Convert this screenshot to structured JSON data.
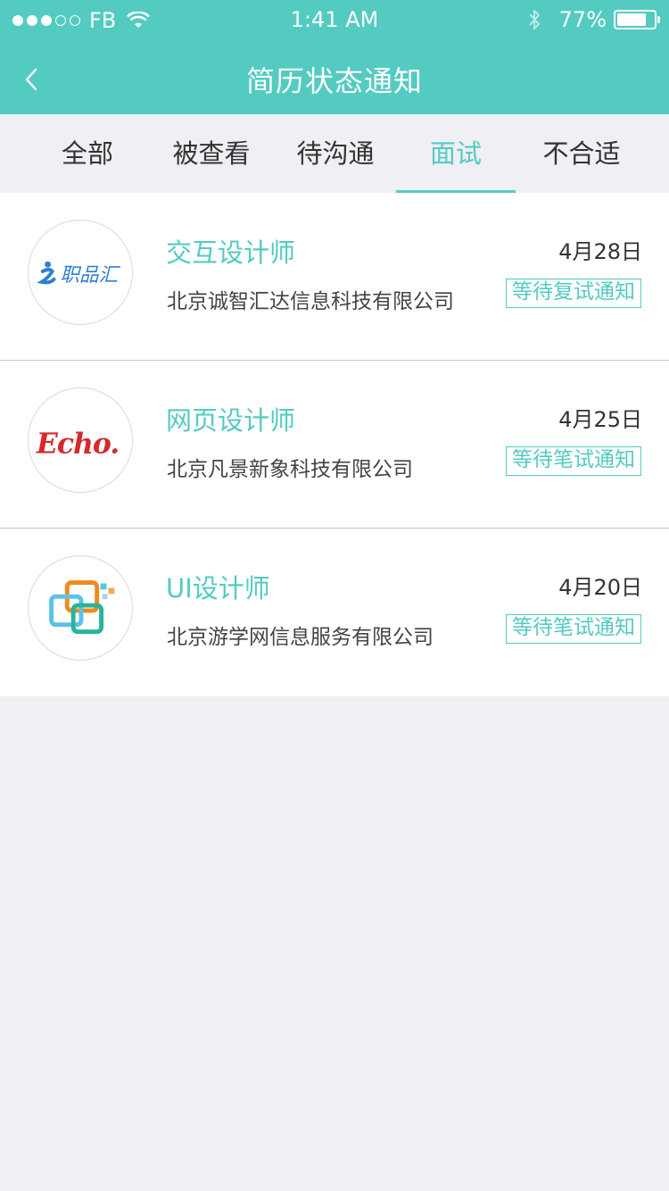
{
  "status_bar": {
    "carrier": "FB",
    "time": "1:41 AM",
    "battery_pct": "77%",
    "battery_level": 0.77,
    "signal_bars_filled": 3,
    "signal_bars_total": 5
  },
  "nav": {
    "title": "简历状态通知",
    "back_icon": "chevron-left-icon"
  },
  "tabs": [
    {
      "label": "全部",
      "active": false
    },
    {
      "label": "被查看",
      "active": false
    },
    {
      "label": "待沟通",
      "active": false
    },
    {
      "label": "面试",
      "active": true
    },
    {
      "label": "不合适",
      "active": false
    }
  ],
  "items": [
    {
      "title": "交互设计师",
      "date": "4月28日",
      "company": "北京诚智汇达信息科技有限公司",
      "status": "等待复试通知",
      "logo": {
        "name": "zhipinhui-logo",
        "text": "职品汇"
      }
    },
    {
      "title": "网页设计师",
      "date": "4月25日",
      "company": "北京凡景新象科技有限公司",
      "status": "等待笔试通知",
      "logo": {
        "name": "echo-logo",
        "text": "Echo."
      }
    },
    {
      "title": "UI设计师",
      "date": "4月20日",
      "company": "北京游学网信息服务有限公司",
      "status": "等待笔试通知",
      "logo": {
        "name": "overlapping-squares-logo"
      }
    }
  ],
  "colors": {
    "accent": "#53cbc1",
    "background": "#efeff4",
    "text": "#333333",
    "divider": "#c8c8cc"
  }
}
